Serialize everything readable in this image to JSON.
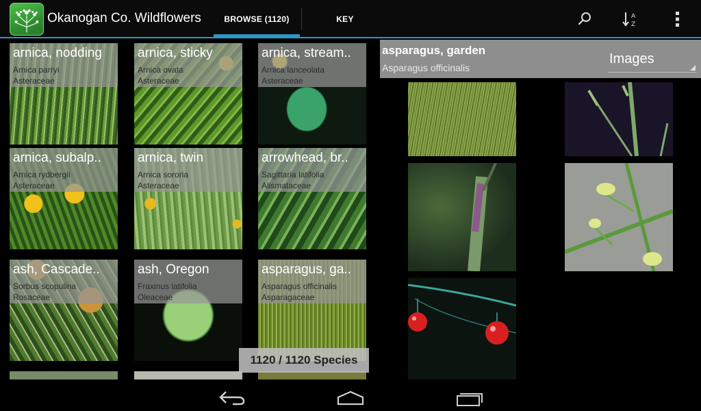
{
  "app": {
    "title": "Okanogan Co. Wildflowers",
    "icon": "wildflower-app-icon"
  },
  "tabs": [
    {
      "label": "BROWSE (1120)",
      "selected": true
    },
    {
      "label": "KEY",
      "selected": false
    }
  ],
  "actions": {
    "search_icon": "search-icon",
    "sort_icon": "sort-az-icon",
    "overflow_icon": "overflow-menu-icon"
  },
  "species_grid": [
    {
      "name": "arnica, nodding",
      "scientific": "Arnica parryi",
      "family": "Asteraceae"
    },
    {
      "name": "arnica, sticky",
      "scientific": "Arnica ovata",
      "family": "Asteraceae"
    },
    {
      "name": "arnica, stream..",
      "scientific": "Arnica lanceolata",
      "family": "Asteraceae"
    },
    {
      "name": "arnica, subalp..",
      "scientific": "Arnica rydbergii",
      "family": "Asteraceae"
    },
    {
      "name": "arnica, twin",
      "scientific": "Arnica sororia",
      "family": "Asteraceae"
    },
    {
      "name": "arrowhead, br..",
      "scientific": "Sagittaria latifolia",
      "family": "Alismataceae"
    },
    {
      "name": "ash, Cascade..",
      "scientific": "Sorbus scopulina",
      "family": "Rosaceae"
    },
    {
      "name": "ash, Oregon",
      "scientific": "Fraxinus latifolia",
      "family": "Oleaceae"
    },
    {
      "name": "asparagus, ga..",
      "scientific": "Asparagus officinalis",
      "family": "Asparagaceae"
    }
  ],
  "species_count": "1120 / 1120 Species",
  "detail": {
    "name": "asparagus, garden",
    "scientific": "Asparagus officinalis",
    "view_mode": "Images"
  },
  "navigation": {
    "back_icon": "back-icon",
    "home_icon": "home-icon",
    "recents_icon": "recents-icon"
  },
  "colors": {
    "accent": "#2f97c6",
    "header_gray": "#8e8e8e",
    "background": "#000000"
  }
}
